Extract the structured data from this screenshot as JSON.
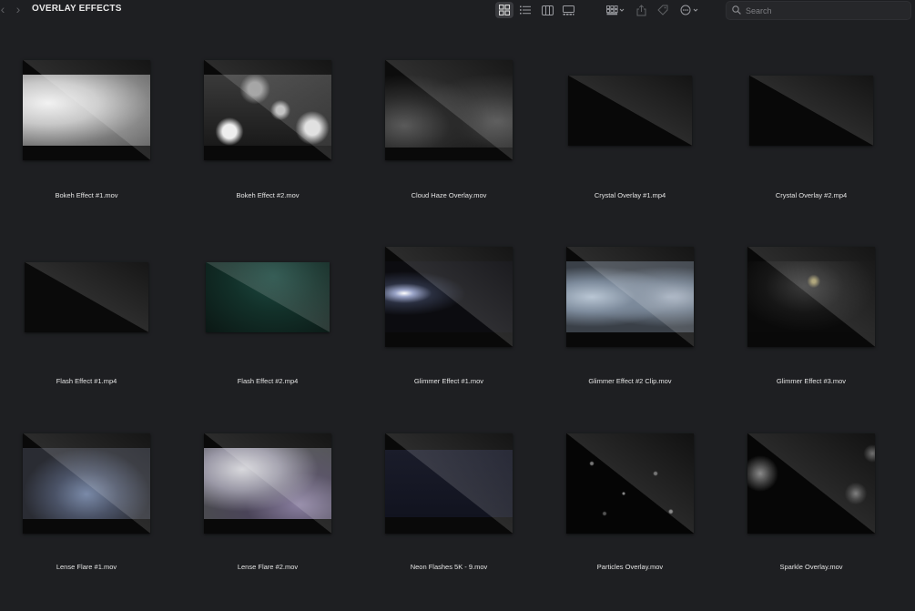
{
  "toolbar": {
    "title": "OVERLAY EFFECTS",
    "back_icon": "chevron-left-icon",
    "forward_icon": "chevron-right-icon",
    "view_modes": [
      "grid-view-icon",
      "list-view-icon",
      "column-view-icon",
      "gallery-view-icon"
    ],
    "active_view": "grid-view-icon",
    "search_placeholder": "Search"
  },
  "files": [
    {
      "name": "Bokeh Effect #1.mov"
    },
    {
      "name": "Bokeh Effect #2.mov"
    },
    {
      "name": "Cloud Haze Overlay.mov"
    },
    {
      "name": "Crystal Overlay #1.mp4"
    },
    {
      "name": "Crystal Overlay #2.mp4"
    },
    {
      "name": "Flash Effect #1.mp4"
    },
    {
      "name": "Flash Effect #2.mp4"
    },
    {
      "name": "Glimmer Effect #1.mov"
    },
    {
      "name": "Glimmer Effect #2 Clip.mov"
    },
    {
      "name": "Glimmer Effect #3.mov"
    },
    {
      "name": "Lense Flare #1.mov"
    },
    {
      "name": "Lense Flare #2.mov"
    },
    {
      "name": "Neon Flashes 5K - 9.mov"
    },
    {
      "name": "Particles Overlay.mov"
    },
    {
      "name": "Sparkle Overlay.mov"
    }
  ],
  "colors": {
    "background": "#1e1f22",
    "toolbar_active": "#3a3b3f",
    "label_text": "#e4e4e4"
  }
}
